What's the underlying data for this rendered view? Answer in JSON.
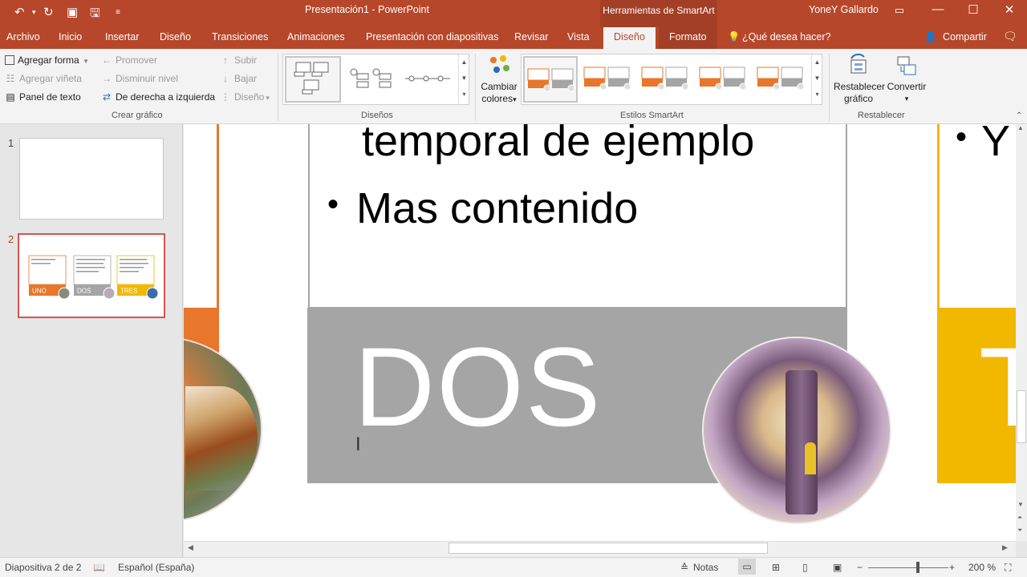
{
  "titlebar": {
    "doc_title": "Presentación1 - PowerPoint",
    "context_tab": "Herramientas de SmartArt",
    "user": "YoneY Gallardo",
    "accent": "#b7472a"
  },
  "tabs": [
    "Archivo",
    "Inicio",
    "Insertar",
    "Diseño",
    "Transiciones",
    "Animaciones",
    "Presentación con diapositivas",
    "Revisar",
    "Vista"
  ],
  "ctx_tabs": {
    "design": "Diseño",
    "format": "Formato"
  },
  "tell_me": "¿Qué desea hacer?",
  "share": "Compartir",
  "ribbon": {
    "crear": {
      "add_shape": "Agregar forma",
      "add_bullet": "Agregar viñeta",
      "text_pane": "Panel de texto",
      "promote": "Promover",
      "demote": "Disminuir nivel",
      "rtl": "De derecha a izquierda",
      "up": "Subir",
      "down": "Bajar",
      "layout": "Diseño",
      "label": "Crear gráfico"
    },
    "layouts_label": "Diseños",
    "change_colors": [
      "Cambiar",
      "colores"
    ],
    "styles_label": "Estilos SmartArt",
    "reset_graphic": [
      "Restablecer",
      "gráfico"
    ],
    "convert": "Convertir",
    "reset_label": "Restablecer"
  },
  "thumbs": {
    "slide1_num": "1",
    "slide2_num": "2",
    "labels": [
      "UNO",
      "DOS",
      "TRES"
    ]
  },
  "slide": {
    "line1": "temporal de ejemplo",
    "line2": "Mas contenido",
    "right_bullet": "Y",
    "card_title": "DOS",
    "right_card_partial": "T",
    "colors": {
      "orange": "#e8762c",
      "gray": "#a5a5a5",
      "yellow": "#f2b800"
    }
  },
  "status": {
    "slide_info": "Diapositiva 2 de 2",
    "language": "Español (España)",
    "notes": "Notas",
    "zoom": "200 %"
  }
}
